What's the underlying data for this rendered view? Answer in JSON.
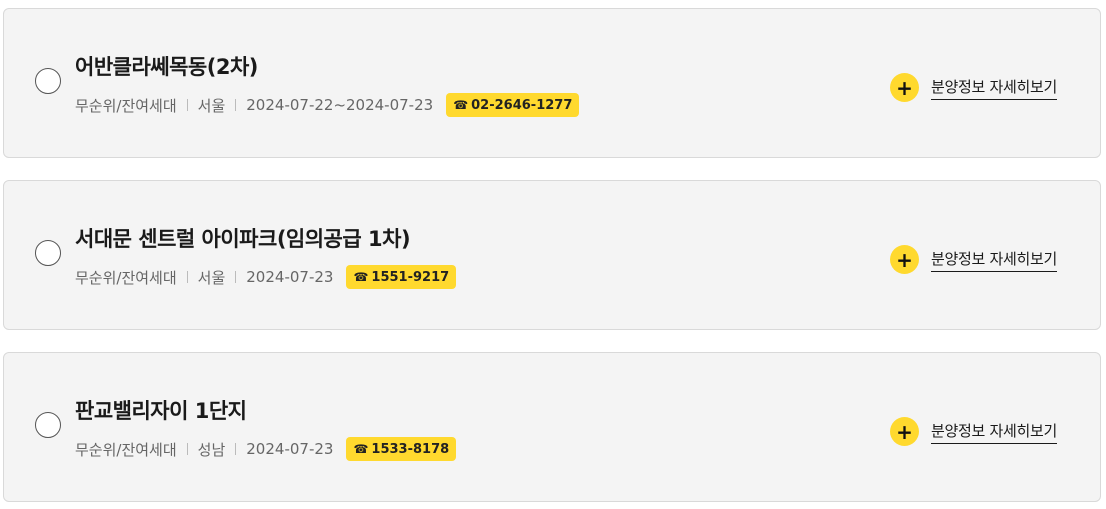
{
  "listings": [
    {
      "title": "어반클라쎄목동(2차)",
      "type": "무순위/잔여세대",
      "region": "서울",
      "date": "2024-07-22~2024-07-23",
      "phone": "02-2646-1277",
      "detail_label": "분양정보 자세히보기"
    },
    {
      "title": "서대문 센트럴 아이파크(임의공급 1차)",
      "type": "무순위/잔여세대",
      "region": "서울",
      "date": "2024-07-23",
      "phone": "1551-9217",
      "detail_label": "분양정보 자세히보기"
    },
    {
      "title": "판교밸리자이 1단지",
      "type": "무순위/잔여세대",
      "region": "성남",
      "date": "2024-07-23",
      "phone": "1533-8178",
      "detail_label": "분양정보 자세히보기"
    }
  ],
  "icons": {
    "phone": "☎",
    "plus": "+"
  },
  "colors": {
    "accent": "#ffd92e",
    "card_background": "#f4f4f4",
    "card_border": "#d9d9d9"
  }
}
